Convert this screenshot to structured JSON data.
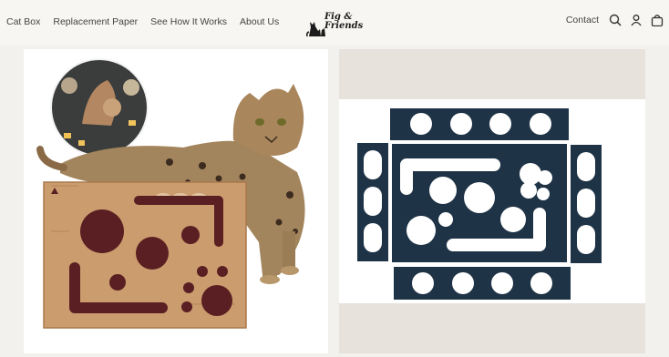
{
  "header": {
    "nav": [
      {
        "label": "Cat Box"
      },
      {
        "label": "Replacement Paper"
      },
      {
        "label": "See How It Works"
      },
      {
        "label": "About Us"
      }
    ],
    "logo": {
      "line1": "Fig &",
      "line2": "Friends"
    },
    "contact_label": "Contact",
    "icons": [
      "search-icon",
      "account-icon",
      "cart-icon"
    ]
  },
  "gallery": {
    "left_image": {
      "box_logo_text": "Fig & Friends",
      "theme_colors": {
        "wood": "#c79a6a",
        "hole": "#5a1f22",
        "cat_fur": "#a08060"
      }
    },
    "right_image": {
      "theme_colors": {
        "paper": "#1f3346",
        "background": "#e7e2dc"
      }
    }
  },
  "colors": {
    "page_bg": "#f3f1ed",
    "header_bg": "#f7f6f3",
    "text": "#444444"
  }
}
